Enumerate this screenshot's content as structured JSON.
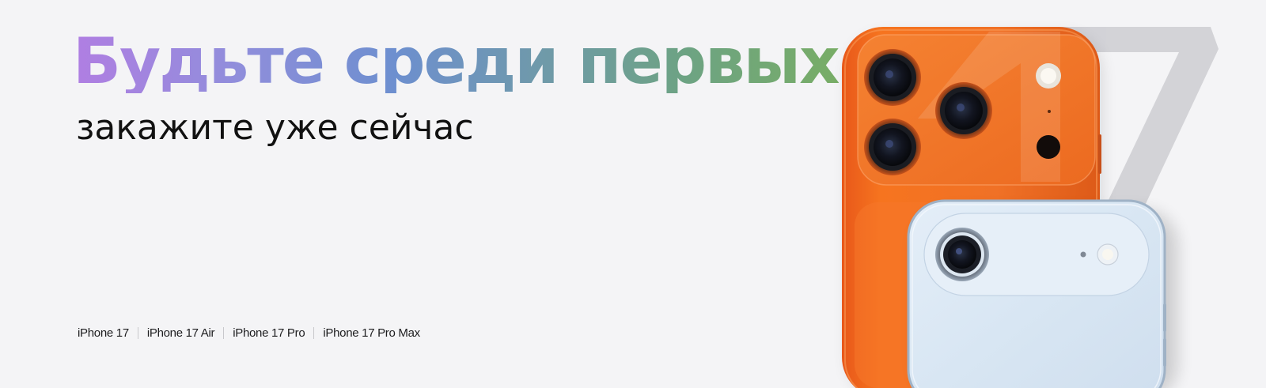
{
  "hero": {
    "headline": "Будьте среди первых",
    "subheadline": "закажите уже сейчас"
  },
  "models": [
    {
      "label": "iPhone 17"
    },
    {
      "label": "iPhone 17 Air"
    },
    {
      "label": "iPhone 17 Pro"
    },
    {
      "label": "iPhone 17 Pro Max"
    }
  ],
  "visual": {
    "graphic_number": "17",
    "colors": {
      "background": "#f4f4f6",
      "orange_phone": "#f26a1f",
      "blue_phone": "#dce9f4",
      "headline_gradient_start": "#b07ee2",
      "headline_gradient_end": "#78ad66"
    }
  }
}
